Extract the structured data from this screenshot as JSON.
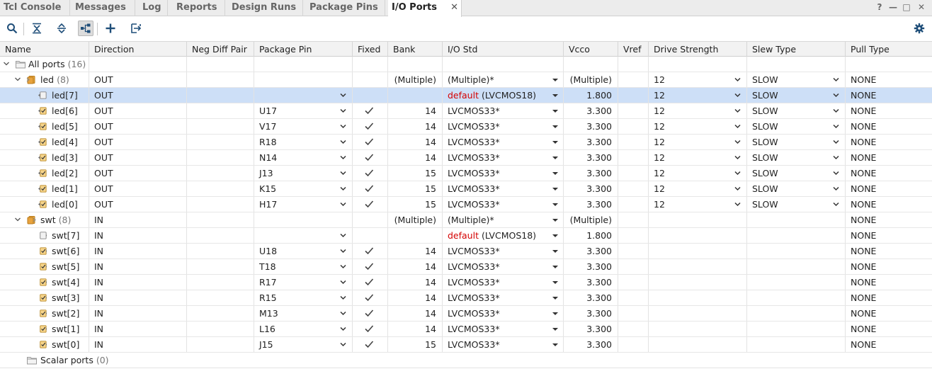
{
  "tabs": [
    {
      "label": "Tcl Console"
    },
    {
      "label": "Messages"
    },
    {
      "label": "Log"
    },
    {
      "label": "Reports"
    },
    {
      "label": "Design Runs"
    },
    {
      "label": "Package Pins"
    },
    {
      "label": "I/O Ports",
      "active": true
    }
  ],
  "window_controls": {
    "help": "?",
    "minimize": "—",
    "restore": "□",
    "close": "✕"
  },
  "tab_close": "✕",
  "toolbar": [
    "search-icon",
    "collapse-all-icon",
    "expand-all-icon",
    "group-by-interface-icon",
    "add-icon",
    "export-icon",
    "gear-icon"
  ],
  "columns": [
    "Name",
    "Direction",
    "Neg Diff Pair",
    "Package Pin",
    "Fixed",
    "Bank",
    "I/O Std",
    "Vcco",
    "Vref",
    "Drive Strength",
    "Slew Type",
    "Pull Type"
  ],
  "all_ports": {
    "label": "All ports",
    "count": "(16)"
  },
  "scalar_ports": {
    "label": "Scalar ports",
    "count": "(0)"
  },
  "groups": [
    {
      "name": "led",
      "count": "(8)",
      "direction": "OUT",
      "bank": "(Multiple)",
      "iostd": "(Multiple)*",
      "vcco": "(Multiple)",
      "drive": "12",
      "slew": "SLOW",
      "pull": "NONE",
      "ports": [
        {
          "name": "led[7]",
          "direction": "OUT",
          "pin": "",
          "fixed": false,
          "bank": "",
          "iostd_default": "default",
          "iostd": "(LVCMOS18)",
          "vcco": "1.800",
          "drive": "12",
          "slew": "SLOW",
          "pull": "NONE",
          "selected": true
        },
        {
          "name": "led[6]",
          "direction": "OUT",
          "pin": "U17",
          "fixed": true,
          "bank": "14",
          "iostd": "LVCMOS33*",
          "vcco": "3.300",
          "drive": "12",
          "slew": "SLOW",
          "pull": "NONE"
        },
        {
          "name": "led[5]",
          "direction": "OUT",
          "pin": "V17",
          "fixed": true,
          "bank": "14",
          "iostd": "LVCMOS33*",
          "vcco": "3.300",
          "drive": "12",
          "slew": "SLOW",
          "pull": "NONE"
        },
        {
          "name": "led[4]",
          "direction": "OUT",
          "pin": "R18",
          "fixed": true,
          "bank": "14",
          "iostd": "LVCMOS33*",
          "vcco": "3.300",
          "drive": "12",
          "slew": "SLOW",
          "pull": "NONE"
        },
        {
          "name": "led[3]",
          "direction": "OUT",
          "pin": "N14",
          "fixed": true,
          "bank": "14",
          "iostd": "LVCMOS33*",
          "vcco": "3.300",
          "drive": "12",
          "slew": "SLOW",
          "pull": "NONE"
        },
        {
          "name": "led[2]",
          "direction": "OUT",
          "pin": "J13",
          "fixed": true,
          "bank": "15",
          "iostd": "LVCMOS33*",
          "vcco": "3.300",
          "drive": "12",
          "slew": "SLOW",
          "pull": "NONE"
        },
        {
          "name": "led[1]",
          "direction": "OUT",
          "pin": "K15",
          "fixed": true,
          "bank": "15",
          "iostd": "LVCMOS33*",
          "vcco": "3.300",
          "drive": "12",
          "slew": "SLOW",
          "pull": "NONE"
        },
        {
          "name": "led[0]",
          "direction": "OUT",
          "pin": "H17",
          "fixed": true,
          "bank": "15",
          "iostd": "LVCMOS33*",
          "vcco": "3.300",
          "drive": "12",
          "slew": "SLOW",
          "pull": "NONE"
        }
      ]
    },
    {
      "name": "swt",
      "count": "(8)",
      "direction": "IN",
      "bank": "(Multiple)",
      "iostd": "(Multiple)*",
      "vcco": "(Multiple)",
      "drive": "",
      "slew": "",
      "pull": "NONE",
      "ports": [
        {
          "name": "swt[7]",
          "direction": "IN",
          "pin": "",
          "fixed": false,
          "bank": "",
          "iostd_default": "default",
          "iostd": "(LVCMOS18)",
          "vcco": "1.800",
          "drive": "",
          "slew": "",
          "pull": "NONE"
        },
        {
          "name": "swt[6]",
          "direction": "IN",
          "pin": "U18",
          "fixed": true,
          "bank": "14",
          "iostd": "LVCMOS33*",
          "vcco": "3.300",
          "drive": "",
          "slew": "",
          "pull": "NONE"
        },
        {
          "name": "swt[5]",
          "direction": "IN",
          "pin": "T18",
          "fixed": true,
          "bank": "14",
          "iostd": "LVCMOS33*",
          "vcco": "3.300",
          "drive": "",
          "slew": "",
          "pull": "NONE"
        },
        {
          "name": "swt[4]",
          "direction": "IN",
          "pin": "R17",
          "fixed": true,
          "bank": "14",
          "iostd": "LVCMOS33*",
          "vcco": "3.300",
          "drive": "",
          "slew": "",
          "pull": "NONE"
        },
        {
          "name": "swt[3]",
          "direction": "IN",
          "pin": "R15",
          "fixed": true,
          "bank": "14",
          "iostd": "LVCMOS33*",
          "vcco": "3.300",
          "drive": "",
          "slew": "",
          "pull": "NONE"
        },
        {
          "name": "swt[2]",
          "direction": "IN",
          "pin": "M13",
          "fixed": true,
          "bank": "14",
          "iostd": "LVCMOS33*",
          "vcco": "3.300",
          "drive": "",
          "slew": "",
          "pull": "NONE"
        },
        {
          "name": "swt[1]",
          "direction": "IN",
          "pin": "L16",
          "fixed": true,
          "bank": "14",
          "iostd": "LVCMOS33*",
          "vcco": "3.300",
          "drive": "",
          "slew": "",
          "pull": "NONE"
        },
        {
          "name": "swt[0]",
          "direction": "IN",
          "pin": "J15",
          "fixed": true,
          "bank": "15",
          "iostd": "LVCMOS33*",
          "vcco": "3.300",
          "drive": "",
          "slew": "",
          "pull": "NONE"
        }
      ]
    }
  ],
  "colors": {
    "selected_row": "#cddff7",
    "default_text": "#d40000",
    "icon_orange": "#e8a33d"
  }
}
